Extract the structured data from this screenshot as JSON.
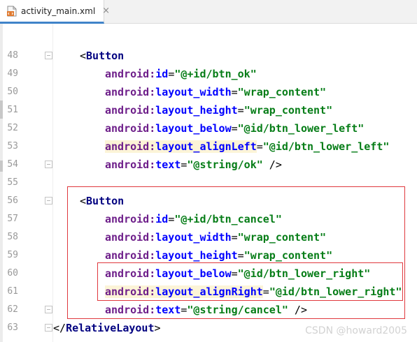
{
  "tab": {
    "file_name": "activity_main.xml",
    "close_glyph": "×",
    "icon": "xml-file-icon"
  },
  "lines": [
    {
      "number": "48",
      "fold": true,
      "indent": 1,
      "highlight": false,
      "tokens": [
        [
          "punc",
          "<"
        ],
        [
          "tag",
          "Button"
        ]
      ]
    },
    {
      "number": "49",
      "fold": false,
      "indent": 2,
      "highlight": false,
      "tokens": [
        [
          "ns",
          "android:"
        ],
        [
          "attr",
          "id"
        ],
        [
          "eq",
          "="
        ],
        [
          "val",
          "\"@+id/btn_ok\""
        ]
      ]
    },
    {
      "number": "50",
      "fold": false,
      "indent": 2,
      "highlight": false,
      "tokens": [
        [
          "ns",
          "android:"
        ],
        [
          "attr",
          "layout_width"
        ],
        [
          "eq",
          "="
        ],
        [
          "val",
          "\"wrap_content\""
        ]
      ]
    },
    {
      "number": "51",
      "fold": false,
      "indent": 2,
      "highlight": false,
      "tokens": [
        [
          "ns",
          "android:"
        ],
        [
          "attr",
          "layout_height"
        ],
        [
          "eq",
          "="
        ],
        [
          "val",
          "\"wrap_content\""
        ]
      ]
    },
    {
      "number": "52",
      "fold": false,
      "indent": 2,
      "highlight": false,
      "tokens": [
        [
          "ns",
          "android:"
        ],
        [
          "attr",
          "layout_below"
        ],
        [
          "eq",
          "="
        ],
        [
          "val",
          "\"@id/btn_lower_left\""
        ]
      ]
    },
    {
      "number": "53",
      "fold": false,
      "indent": 2,
      "highlight": true,
      "tokens": [
        [
          "ns",
          "android:"
        ],
        [
          "attr",
          "layout_alignLeft"
        ],
        [
          "eq",
          "="
        ],
        [
          "val",
          "\"@id/btn_lower_left\""
        ]
      ]
    },
    {
      "number": "54",
      "fold": true,
      "indent": 2,
      "highlight": false,
      "tokens": [
        [
          "ns",
          "android:"
        ],
        [
          "attr",
          "text"
        ],
        [
          "eq",
          "="
        ],
        [
          "val",
          "\"@string/ok\""
        ],
        [
          "punc",
          " />"
        ]
      ]
    },
    {
      "number": "55",
      "fold": false,
      "indent": 0,
      "highlight": false,
      "tokens": []
    },
    {
      "number": "56",
      "fold": true,
      "indent": 1,
      "highlight": false,
      "tokens": [
        [
          "punc",
          "<"
        ],
        [
          "tag",
          "Button"
        ]
      ]
    },
    {
      "number": "57",
      "fold": false,
      "indent": 2,
      "highlight": false,
      "tokens": [
        [
          "ns",
          "android:"
        ],
        [
          "attr",
          "id"
        ],
        [
          "eq",
          "="
        ],
        [
          "val",
          "\"@+id/btn_cancel\""
        ]
      ]
    },
    {
      "number": "58",
      "fold": false,
      "indent": 2,
      "highlight": false,
      "tokens": [
        [
          "ns",
          "android:"
        ],
        [
          "attr",
          "layout_width"
        ],
        [
          "eq",
          "="
        ],
        [
          "val",
          "\"wrap_content\""
        ]
      ]
    },
    {
      "number": "59",
      "fold": false,
      "indent": 2,
      "highlight": false,
      "tokens": [
        [
          "ns",
          "android:"
        ],
        [
          "attr",
          "layout_height"
        ],
        [
          "eq",
          "="
        ],
        [
          "val",
          "\"wrap_content\""
        ]
      ]
    },
    {
      "number": "60",
      "fold": false,
      "indent": 2,
      "highlight": false,
      "tokens": [
        [
          "ns",
          "android:"
        ],
        [
          "attr",
          "layout_below"
        ],
        [
          "eq",
          "="
        ],
        [
          "val",
          "\"@id/btn_lower_right\""
        ]
      ]
    },
    {
      "number": "61",
      "fold": false,
      "indent": 2,
      "highlight": true,
      "tokens": [
        [
          "ns",
          "android:"
        ],
        [
          "attr",
          "layout_alignRight"
        ],
        [
          "eq",
          "="
        ],
        [
          "val",
          "\"@id/btn_lower_right\""
        ]
      ]
    },
    {
      "number": "62",
      "fold": true,
      "indent": 2,
      "highlight": false,
      "tokens": [
        [
          "ns",
          "android:"
        ],
        [
          "attr",
          "text"
        ],
        [
          "eq",
          "="
        ],
        [
          "val",
          "\"@string/cancel\""
        ],
        [
          "punc",
          " />"
        ]
      ]
    },
    {
      "number": "63",
      "fold": true,
      "indent": 0,
      "highlight": false,
      "tokens": [
        [
          "punc",
          "</"
        ],
        [
          "tag",
          "RelativeLayout"
        ],
        [
          "punc",
          ">"
        ]
      ]
    }
  ],
  "watermark": "CSDN @howard2005",
  "colors": {
    "tag": "#000080",
    "namespace": "#6e1f8a",
    "attribute": "#0000ff",
    "value": "#067d17",
    "highlight": "#fcf4d7",
    "annotation_box": "#e0393e"
  }
}
